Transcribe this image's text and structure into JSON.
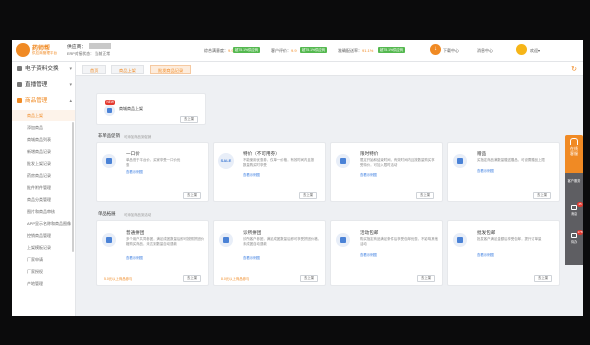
{
  "header": {
    "brand_name": "药师帮",
    "brand_sub": "供应商管理平台",
    "supplier_label": "供应商：",
    "supplier_sub": "ERP对接状态： 当前正常",
    "metrics": [
      {
        "label": "综合满意度：",
        "value": "9.9",
        "pill": "超75.1%供应商"
      },
      {
        "label": "客户评价：",
        "value": "9.9",
        "pill": "超75.1%供应商"
      },
      {
        "label": "准确配送率：",
        "value": "91.1%",
        "pill": "超75.1%供应商"
      }
    ],
    "menu_download": "下载中心",
    "menu_messages": "消息中心",
    "greeting": "欢迎",
    "colors": {
      "accent": "#f08a24",
      "pill_green": "#54b84f"
    }
  },
  "sidebar": {
    "groups": [
      {
        "label": "电子资料交换",
        "icon": "document-icon"
      },
      {
        "label": "直播管理",
        "icon": "video-icon"
      },
      {
        "label": "商品管理",
        "icon": "box-icon"
      }
    ],
    "items": [
      "商品上架",
      "添加商品",
      "商城商品列表",
      "新增商品记录",
      "批发上架记录",
      "药房商品记录",
      "批件附件管理",
      "商品分类管理",
      "图片和商品审核",
      "APP显示名称和商品图像",
      "控销商品管理",
      "上架模板记录",
      "厂家申请",
      "厂家授权",
      "产地管理"
    ]
  },
  "tabs": [
    "首页",
    "商品上架",
    "批发商品记录"
  ],
  "quick_card": {
    "badge": "NEW",
    "title": "商城商品上架",
    "button": "去上架"
  },
  "section1": {
    "title": "非单品促销",
    "subtitle": "可添加商品到促销",
    "cards": [
      {
        "icon": "price-tag-icon",
        "title": "一口价",
        "desc": "单品低于平台价，买家享受一口价优惠",
        "link": "查看示例图",
        "button": "去上架"
      },
      {
        "icon": "sale-icon",
        "icon_text": "SALE",
        "title": "特价（不可用券）",
        "desc": "不能使用优惠券，仅单一价格，有效时间内且按数量购买时享受",
        "link": "查看示例图",
        "button": "去上架"
      },
      {
        "icon": "discount-tag-icon",
        "title": "限时特价",
        "desc": "限定开始和结束时间，有效时间内且按数量购买享受特价，可加入限时活动",
        "link": "查看示例图",
        "button": "去上架"
      },
      {
        "icon": "gift-icon",
        "title": "赠品",
        "desc": "买指定商品满数量赠送赠品，可设置赠品上限",
        "link": "查看示例图",
        "button": "去上架"
      }
    ]
  },
  "section2": {
    "title": "单品拓展",
    "subtitle": "可添加商品到活动",
    "cards": [
      {
        "icon": "group-buy-icon",
        "title": "普通拼团",
        "desc": "多个用户共同参团，满足成团数量后即可按照拼团价格购买商品，未达到数量自动退款",
        "link": "查看示例图",
        "note": "5.0元以上商品参与",
        "button": "去上架"
      },
      {
        "icon": "store-icon",
        "title": "诊所拼团",
        "desc": "诊所客户参团，满足成团数量后即可享受拼团价格，未成团自动退款",
        "link": "查看示例图",
        "note": "8.0元以上商品参与",
        "button": "去上架"
      },
      {
        "icon": "coupon-bag-icon",
        "title": "活动包邮",
        "desc": "购买指定商品满足条件后享受包邮优惠，不影响其他活动",
        "link": "查看示例图",
        "note": "",
        "button": "去上架"
      },
      {
        "icon": "service-icon",
        "title": "批发包邮",
        "desc": "批发客户满足金额后享受包邮，提升订单量",
        "link": "查看示例图",
        "note": "",
        "button": "去上架"
      }
    ]
  },
  "right_rail": {
    "top_label": "在线客服",
    "items": [
      {
        "label": "客户服务",
        "badge": ""
      },
      {
        "label": "消息",
        "badge": "45"
      },
      {
        "label": "待办",
        "badge": "178"
      }
    ]
  }
}
